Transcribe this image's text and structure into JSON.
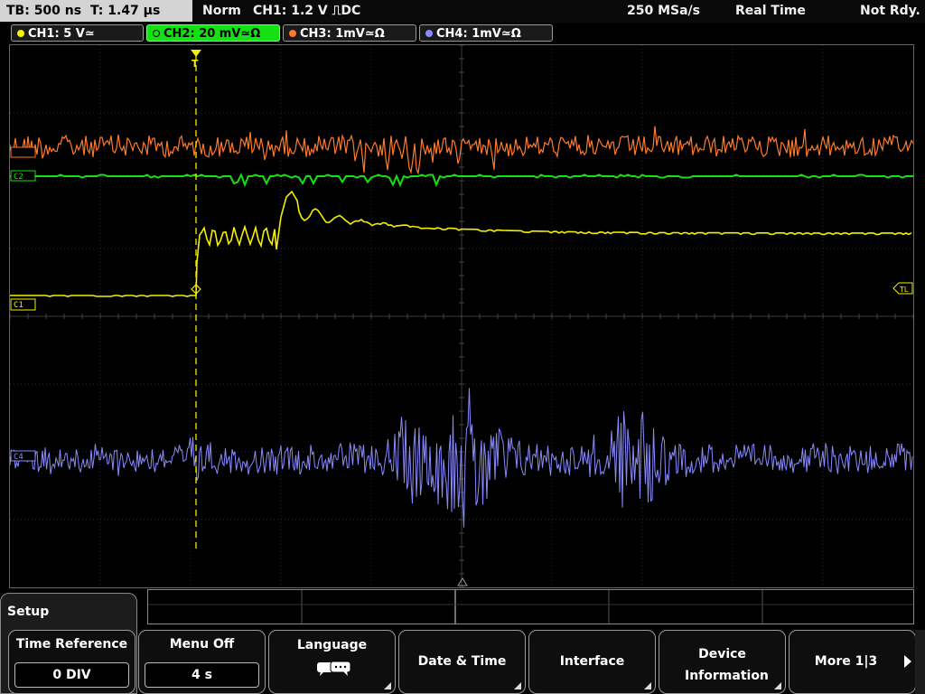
{
  "status": {
    "timebase": "TB: 500 ns",
    "trigger_time": "T: 1.47 µs",
    "mode": "Norm",
    "trigger": "CH1: 1.2 V ⎍DC",
    "sample_rate": "250 MSa/s",
    "acq_mode": "Real Time",
    "trigger_state": "Not Rdy."
  },
  "channels": [
    {
      "label": "CH1: 5 V≃",
      "color": "#f5f000"
    },
    {
      "label": "CH2: 20 mV≃Ω",
      "color": "#14e014"
    },
    {
      "label": "CH3: 1mV≃Ω",
      "color": "#ff7a2a"
    },
    {
      "label": "CH4: 1mV≃Ω",
      "color": "#8a8aff"
    }
  ],
  "markers": {
    "ch1": "C1",
    "ch2": "C2",
    "ch4": "C4",
    "trigger_level": "TL",
    "trigger_position": "T"
  },
  "menu": {
    "title": "Setup",
    "softkeys": [
      {
        "label": "Time Reference",
        "value": "0 DIV"
      },
      {
        "label": "Menu Off",
        "value": "4 s"
      },
      {
        "label": "Language"
      },
      {
        "label": "Date & Time"
      },
      {
        "label": "Interface"
      },
      {
        "label": "Device Information"
      },
      {
        "label": "More 1|3"
      }
    ]
  },
  "icons": [
    "speech-bubbles-icon",
    "submenu-corner-icon",
    "next-arrow-icon",
    "trigger-position-icon"
  ]
}
